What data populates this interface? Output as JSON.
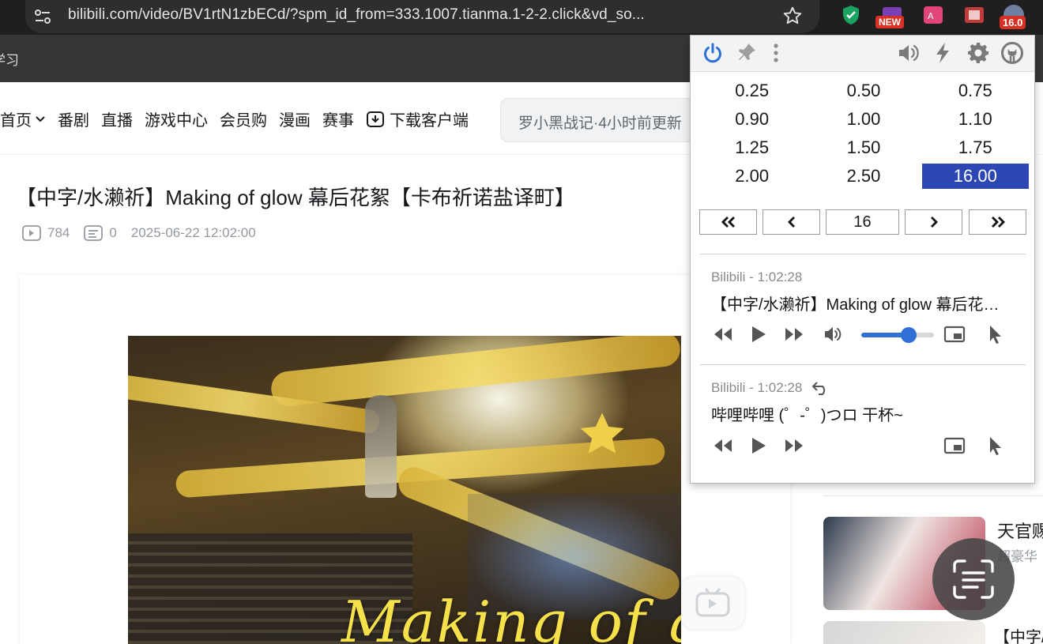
{
  "browser": {
    "url": "bilibili.com/video/BV1rtN1zbECd/?spm_id_from=333.1007.tianma.1-2-2.click&vd_so...",
    "new_badge": "NEW",
    "speed_badge": "16.0",
    "bookmark_fragment": "学习"
  },
  "header": {
    "nav": [
      {
        "label": "首页",
        "has_dropdown": true
      },
      {
        "label": "番剧"
      },
      {
        "label": "直播"
      },
      {
        "label": "游戏中心"
      },
      {
        "label": "会员购"
      },
      {
        "label": "漫画"
      },
      {
        "label": "赛事"
      },
      {
        "label": "下载客户端",
        "icon": "download-icon"
      }
    ],
    "search_placeholder": "罗小黑战记·4小时前更新"
  },
  "video": {
    "title": "【中字/水濑祈】Making of glow 幕后花絮【卡布祈诺盐译町】",
    "views": "784",
    "danmaku": "0",
    "date": "2025-06-22 12:02:00",
    "overlay_text": "Making of glow"
  },
  "sidebar": {
    "rec1_title": "天官赐",
    "rec1_sub": "超豪华",
    "rec2_title": "【中字/"
  },
  "popup": {
    "toolbar_icons": [
      "power-icon",
      "pin-icon",
      "more-icon",
      "volume-icon",
      "lightning-icon",
      "gear-icon",
      "github-icon"
    ],
    "accent_color": "#2c47b4",
    "speeds": [
      "0.25",
      "0.50",
      "0.75",
      "0.90",
      "1.00",
      "1.10",
      "1.25",
      "1.50",
      "1.75",
      "2.00",
      "2.50",
      "16.00"
    ],
    "active_speed": "16.00",
    "step_value": "16",
    "media": [
      {
        "source": "Bilibili - 1:02:28",
        "title": "【中字/水濑祈】Making of glow 幕后花絮【卡布祈诺盐译町】",
        "volume": 0.65,
        "has_volume": true
      },
      {
        "source": "Bilibili - 1:02:28",
        "title": "哔哩哔哩 (゜-゜)つロ 干杯~",
        "has_volume": false,
        "has_undo": true
      }
    ]
  }
}
